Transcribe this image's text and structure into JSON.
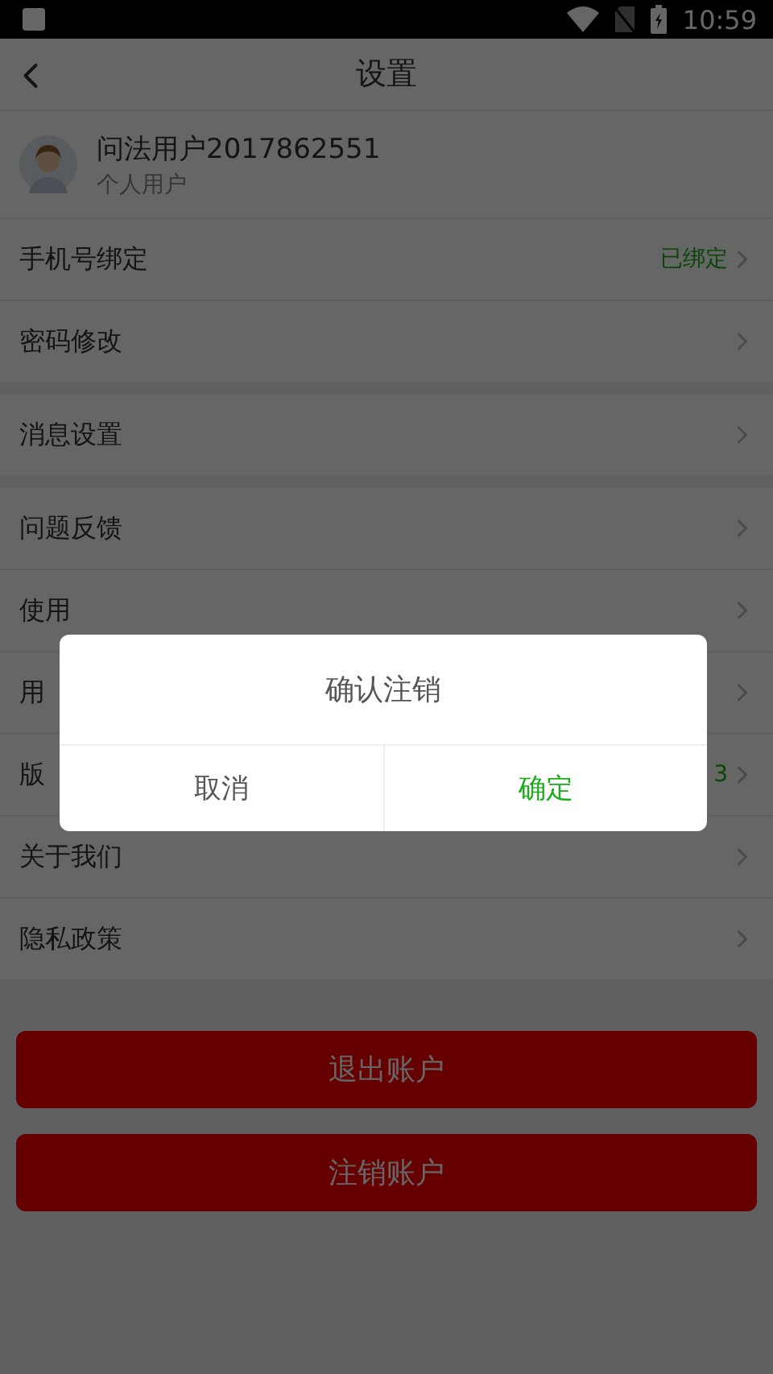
{
  "status_bar": {
    "time": "10:59"
  },
  "nav": {
    "title": "设置"
  },
  "profile": {
    "name": "问法用户2017862551",
    "type": "个人用户"
  },
  "sections": [
    {
      "items": [
        {
          "label": "手机号绑定",
          "value": "已绑定"
        },
        {
          "label": "密码修改"
        }
      ]
    },
    {
      "items": [
        {
          "label": "消息设置"
        }
      ]
    },
    {
      "items": [
        {
          "label": "问题反馈"
        },
        {
          "label": "使用"
        },
        {
          "label": "用"
        },
        {
          "label": "版",
          "value": "3"
        },
        {
          "label": "关于我们"
        },
        {
          "label": "隐私政策"
        }
      ]
    }
  ],
  "buttons": [
    {
      "label": "退出账户"
    },
    {
      "label": "注销账户"
    }
  ],
  "dialog": {
    "title": "确认注销",
    "buttons": [
      {
        "label": "取消",
        "kind": "cancel"
      },
      {
        "label": "确定",
        "kind": "confirm"
      }
    ]
  }
}
